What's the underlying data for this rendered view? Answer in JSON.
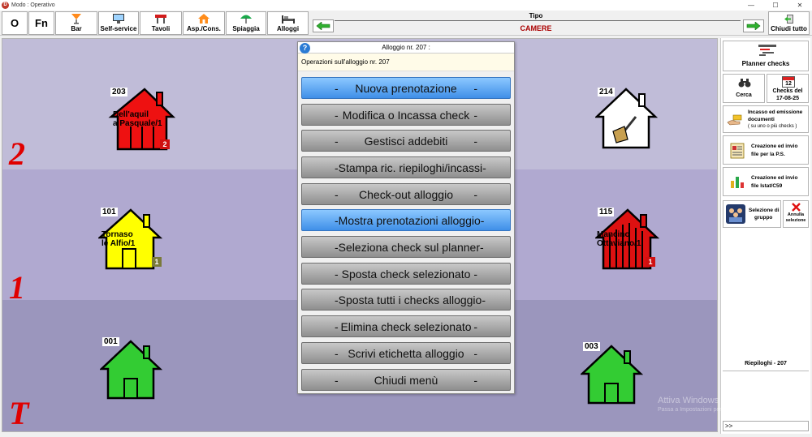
{
  "window": {
    "title": "Modo : Operativo"
  },
  "toolbar": {
    "o_label": "O",
    "fn_label": "Fn",
    "bar_label": "Bar",
    "self_service_label": "Self-service",
    "tavoli_label": "Tavoli",
    "asp_cons_label": "Asp./Cons.",
    "spiaggia_label": "Spiaggia",
    "alloggi_label": "Alloggi",
    "tipo_label": "Tipo",
    "tipo_value": "CAMERE",
    "chiudi_tutto_label": "Chiudi tutto"
  },
  "floors": {
    "f2": "2",
    "f1": "1",
    "fT": "T"
  },
  "rooms": {
    "r203": {
      "num": "203",
      "guest1": "Dell'aquil",
      "guest2": "a Pasquale/1",
      "badge": "2"
    },
    "r214": {
      "num": "214"
    },
    "r101": {
      "num": "101",
      "guest1": "Tornaso",
      "guest2": "le Alfio/1",
      "badge": "1"
    },
    "r115": {
      "num": "115",
      "guest1": "Mancino",
      "guest2": "Ottaviano/1",
      "badge": "1"
    },
    "r001": {
      "num": "001"
    },
    "r003": {
      "num": "003"
    }
  },
  "popup": {
    "title": "Alloggio nr. 207 :",
    "subtitle": "Operazioni  sull'alloggio  nr. 207",
    "dash": "-",
    "items": [
      "Nuova prenotazione",
      "Modifica o Incassa check",
      "Gestisci addebiti",
      "Stampa ric. riepiloghi/incassi",
      "Check-out alloggio",
      "Mostra prenotazioni alloggio",
      "Seleziona check sul planner",
      "Sposta check selezionato",
      "Sposta tutti i checks alloggio",
      "Elimina check selezionato",
      "Scrivi etichetta alloggio",
      "Chiudi menù"
    ]
  },
  "right_panel": {
    "planner_label": "Planner checks",
    "cerca_label": "Cerca",
    "checks_del_label": "Checks del",
    "checks_date": "17-08-25",
    "calendar_day": "12",
    "incasso_line1": "Incasso ed emissione",
    "incasso_line2": "documenti",
    "incasso_line3": "( su uno o più checks )",
    "ps_line1": "Creazione ed invio",
    "ps_line2": "file per la P.S.",
    "istat_line1": "Creazione ed invio",
    "istat_line2": "file Istat/C59",
    "sel_gruppo_line1": "Selezione di",
    "sel_gruppo_line2": "gruppo",
    "annulla_line1": "Annulla",
    "annulla_line2": "selezione",
    "riepiloghi_label": "Riepiloghi - 207",
    "prompt": ">>"
  },
  "watermark": {
    "line1": "Attiva Windows",
    "line2": "Passa a Impostazioni per attivare Windows."
  },
  "colors": {
    "red": "#e00000",
    "yellow": "#ffff00",
    "green": "#33cc33",
    "menu_blue": "#3f8fe8"
  }
}
